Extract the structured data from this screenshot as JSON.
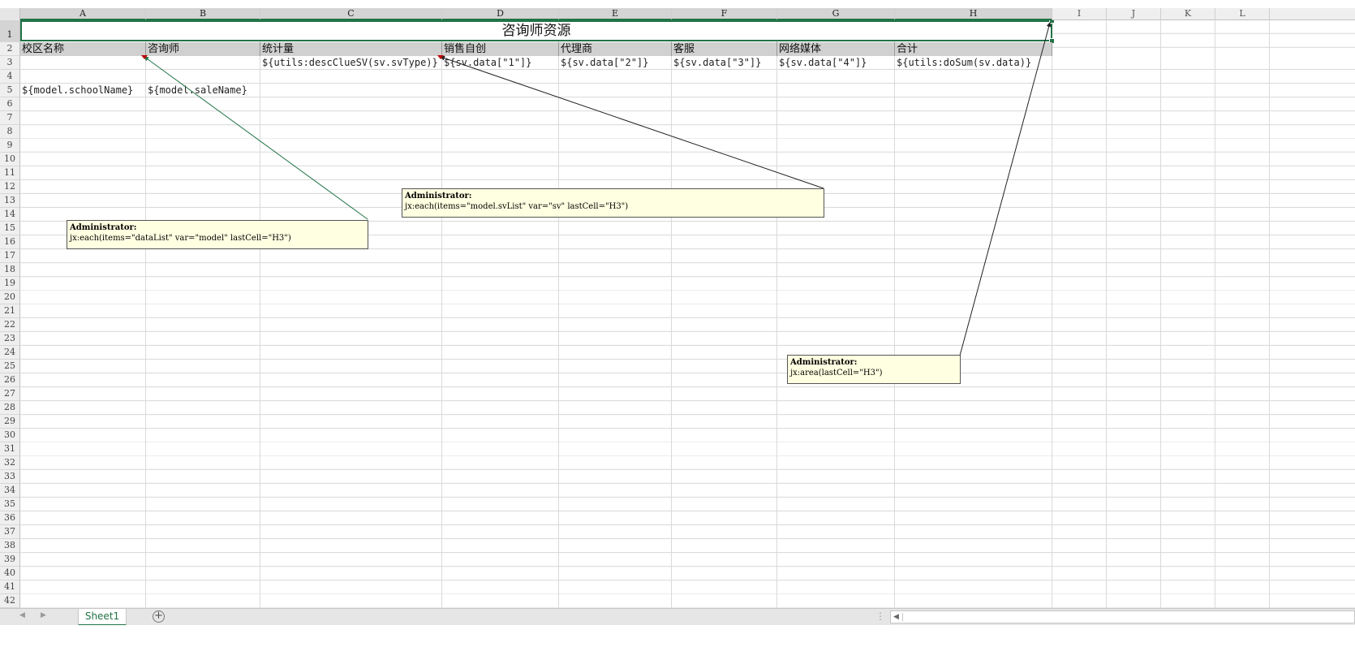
{
  "columns": [
    "A",
    "B",
    "C",
    "D",
    "E",
    "F",
    "G",
    "H",
    "I",
    "J",
    "K",
    "L"
  ],
  "rows": [
    "1",
    "2",
    "3",
    "4",
    "5",
    "6",
    "7",
    "8",
    "9",
    "10",
    "11",
    "12",
    "13",
    "14",
    "15",
    "16",
    "17",
    "18",
    "19",
    "20",
    "21",
    "22",
    "23",
    "24",
    "25",
    "26",
    "27",
    "28",
    "29",
    "30",
    "31",
    "32",
    "33",
    "34",
    "35",
    "36",
    "37",
    "38",
    "39",
    "40",
    "41",
    "42"
  ],
  "sheet": {
    "title": "咨询师资源",
    "headers": [
      "校区名称",
      "咨询师",
      "统计量",
      "销售自创",
      "代理商",
      "客服",
      "网络媒体",
      "合计"
    ],
    "row3": {
      "C": "${utils:descClueSV(sv.svType)}",
      "D": "${sv.data[\"1\"]}",
      "E": "${sv.data[\"2\"]}",
      "F": "${sv.data[\"3\"]}",
      "G": "${sv.data[\"4\"]}",
      "H": "${utils:doSum(sv.data)}"
    },
    "row5": {
      "A": "${model.schoolName}",
      "B": "${model.saleName}"
    }
  },
  "comments": [
    {
      "author": "Administrator:",
      "text": "jx:each(items=\"dataList\" var=\"model\" lastCell=\"H3\")"
    },
    {
      "author": "Administrator:",
      "text": "jx:each(items=\"model.svList\" var=\"sv\" lastCell=\"H3\")"
    },
    {
      "author": "Administrator:",
      "text": "jx:area(lastCell=\"H3\")"
    }
  ],
  "tabs": {
    "active_sheet": "Sheet1",
    "add_label": "+",
    "nav_prev": "◀",
    "nav_next": "▶",
    "scroll_left": "◀",
    "separator": "⋮"
  },
  "colors": {
    "accent": "#217346",
    "comment_bg": "#ffffe1",
    "header_band": "#d0d0d0"
  }
}
